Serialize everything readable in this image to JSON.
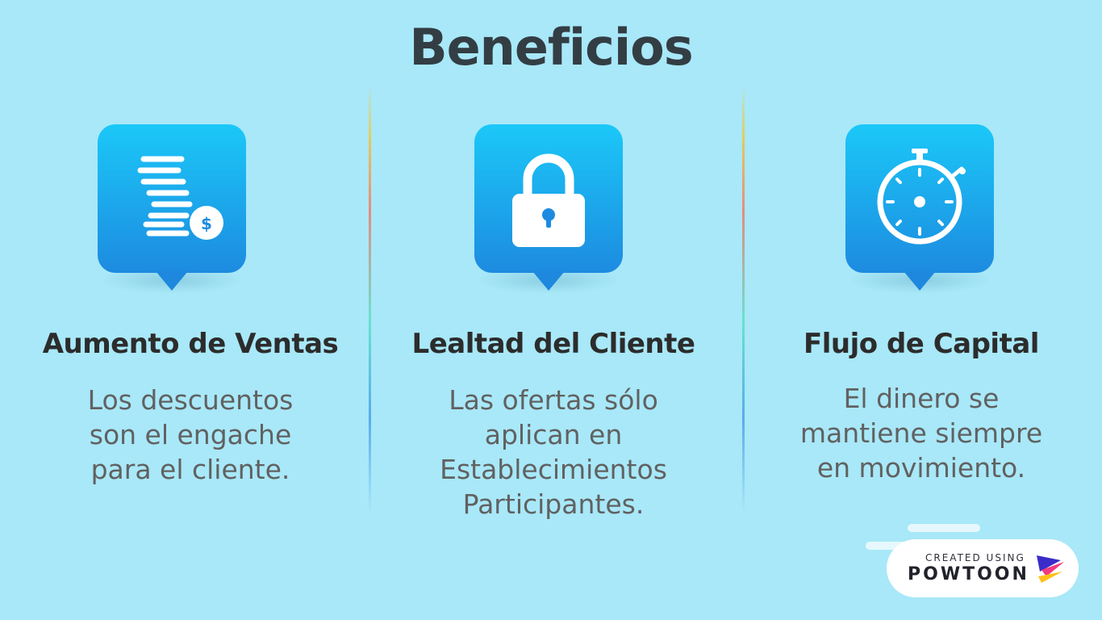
{
  "title": "Beneficios",
  "columns": [
    {
      "icon": "dollar-coins-icon",
      "heading": "Aumento de Ventas",
      "lines": [
        "Los descuentos",
        "son el engache",
        "para el cliente."
      ]
    },
    {
      "icon": "padlock-icon",
      "heading": "Lealtad del Cliente",
      "lines": [
        "Las ofertas sólo",
        "aplican en",
        "Establecimientos",
        "Participantes."
      ]
    },
    {
      "icon": "stopwatch-icon",
      "heading": "Flujo de Capital",
      "lines": [
        "El dinero se",
        "mantiene siempre",
        "en movimiento."
      ]
    }
  ],
  "badge": {
    "small": "CREATED USING",
    "big": "POWTOON",
    "icon": "powtoon-logo-icon"
  },
  "colors": {
    "background": "#a8e8f8",
    "icon_top": "#1bc8f8",
    "icon_bottom": "#1d8be0",
    "title": "#333d44",
    "heading": "#2c2c2c",
    "body": "#616161"
  }
}
